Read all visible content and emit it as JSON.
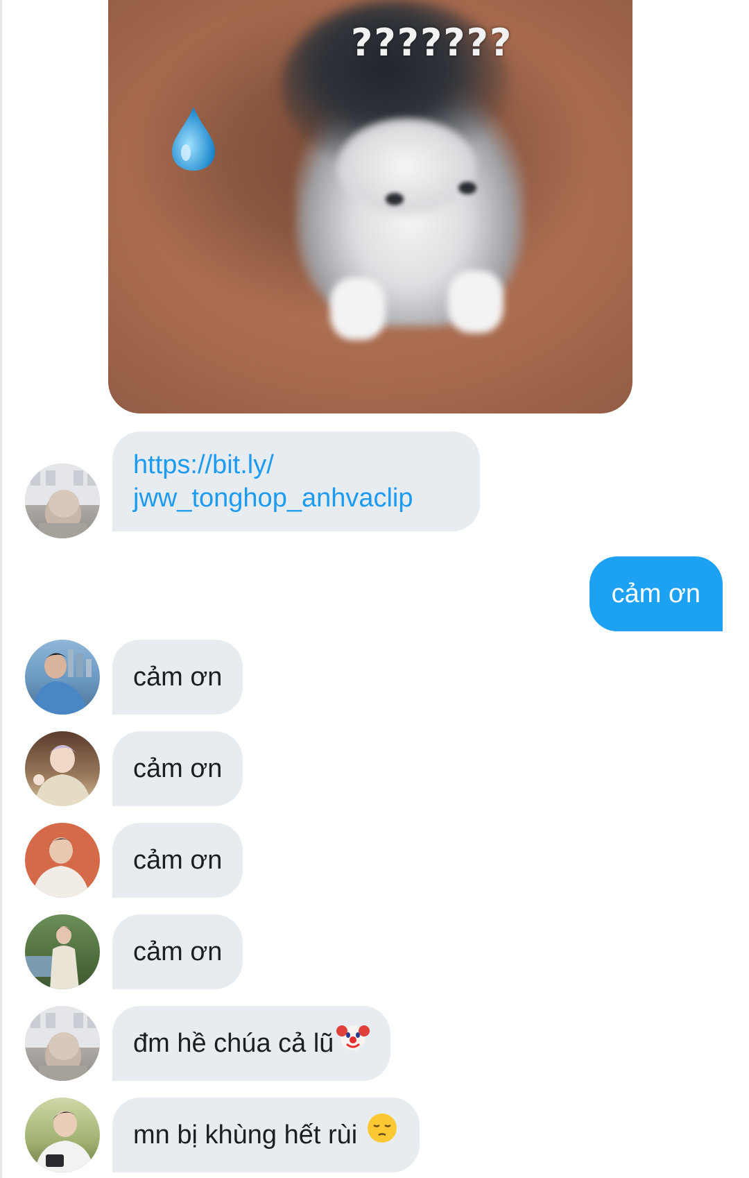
{
  "image_message": {
    "overlay_text": "???????",
    "icon": "sweat-drop-icon"
  },
  "messages": [
    {
      "sender": "other",
      "avatar": "avatar-1",
      "text_line1": "https://bit.ly/",
      "text_line2": "jww_tonghop_anhvaclip",
      "type": "link"
    },
    {
      "sender": "me",
      "text": "cảm ơn"
    },
    {
      "sender": "other",
      "avatar": "avatar-2",
      "text": "cảm ơn"
    },
    {
      "sender": "other",
      "avatar": "avatar-3",
      "text": "cảm ơn"
    },
    {
      "sender": "other",
      "avatar": "avatar-4",
      "text": "cảm ơn"
    },
    {
      "sender": "other",
      "avatar": "avatar-5",
      "text": "cảm ơn"
    },
    {
      "sender": "other",
      "avatar": "avatar-1",
      "text": "đm hề chúa cả lũ",
      "emoji": "clown-face-icon"
    },
    {
      "sender": "other",
      "avatar": "avatar-6",
      "text": "mn bị khùng hết rùi",
      "emoji": "pensive-face-icon"
    }
  ],
  "colors": {
    "my_bubble": "#1da1f2",
    "other_bubble": "#e6ecf0",
    "link": "#1d9bf0"
  }
}
